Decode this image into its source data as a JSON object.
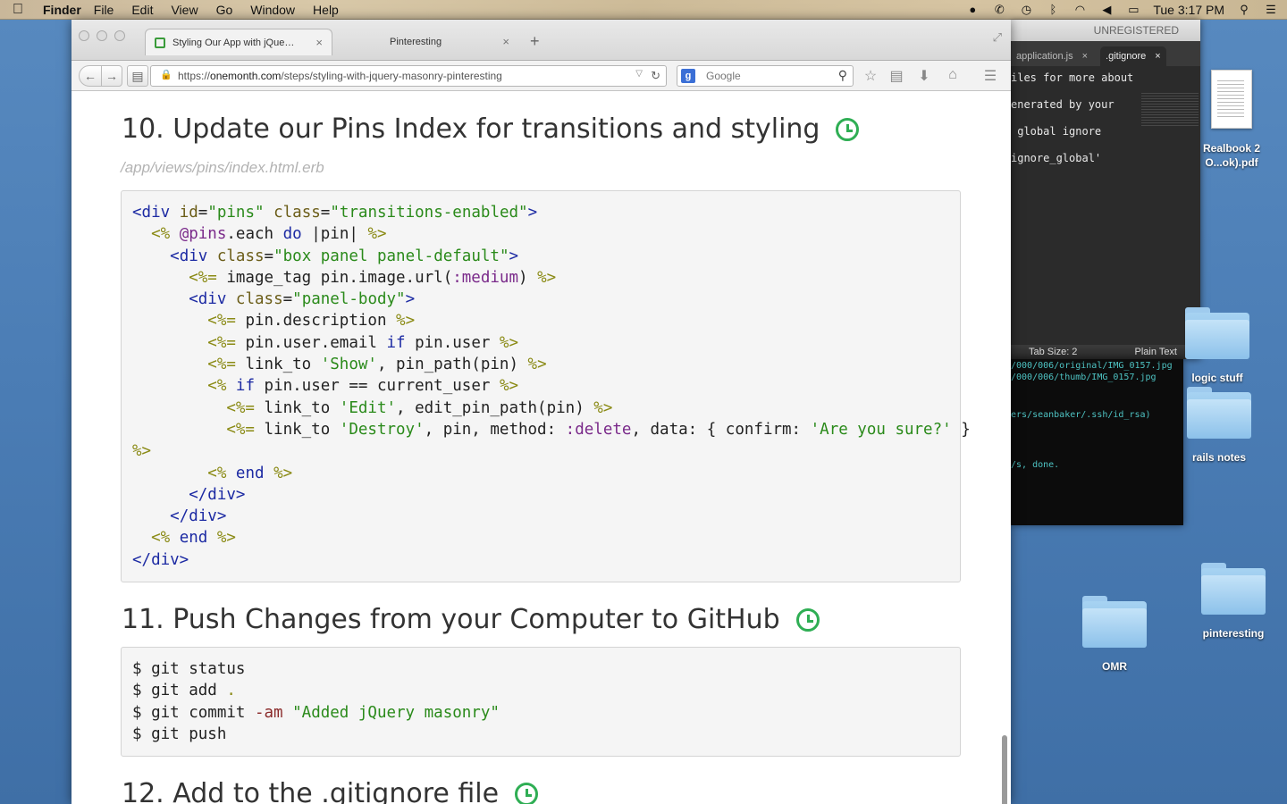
{
  "menubar": {
    "app": "Finder",
    "menus": [
      "File",
      "Edit",
      "View",
      "Go",
      "Window",
      "Help"
    ],
    "clock": "Tue 3:17 PM"
  },
  "browser": {
    "tabs": [
      {
        "label": "Styling Our App with jQue…"
      },
      {
        "label": "Pinteresting"
      }
    ],
    "url_prefix": "https://",
    "url_domain": "onemonth.com",
    "url_path": "/steps/styling-with-jquery-masonry-pinteresting",
    "search_placeholder": "Google"
  },
  "page": {
    "section10": {
      "title": "10. Update our Pins Index for transitions and styling",
      "filepath": "/app/views/pins/index.html.erb"
    },
    "section11": {
      "title": "11. Push Changes from your Computer to GitHub"
    },
    "section12": {
      "title": "12. Add to the .gitignore file"
    }
  },
  "editor": {
    "title": "UNREGISTERED",
    "tabs": [
      "application.js",
      ".gitignore"
    ],
    "lines": [
      "iles for more about",
      "enerated by your",
      " global ignore",
      "ignore_global'"
    ],
    "status_tab": "Tab Size: 2",
    "status_syntax": "Plain Text"
  },
  "terminal": {
    "lines": [
      "/000/006/original/IMG_0157.jpg",
      "/000/006/thumb/IMG_0157.jpg",
      "ers/seanbaker/.ssh/id_rsa)",
      "/s, done."
    ]
  },
  "desktop": {
    "icons": [
      {
        "label": "Realbook 2\nO...ok).pdf"
      },
      {
        "label": "logic stuff"
      },
      {
        "label": "rails notes"
      },
      {
        "label": "OMR"
      },
      {
        "label": "pinteresting"
      }
    ]
  },
  "colors": {
    "accent_green": "#2fae54",
    "code_bg": "#f5f5f5"
  }
}
